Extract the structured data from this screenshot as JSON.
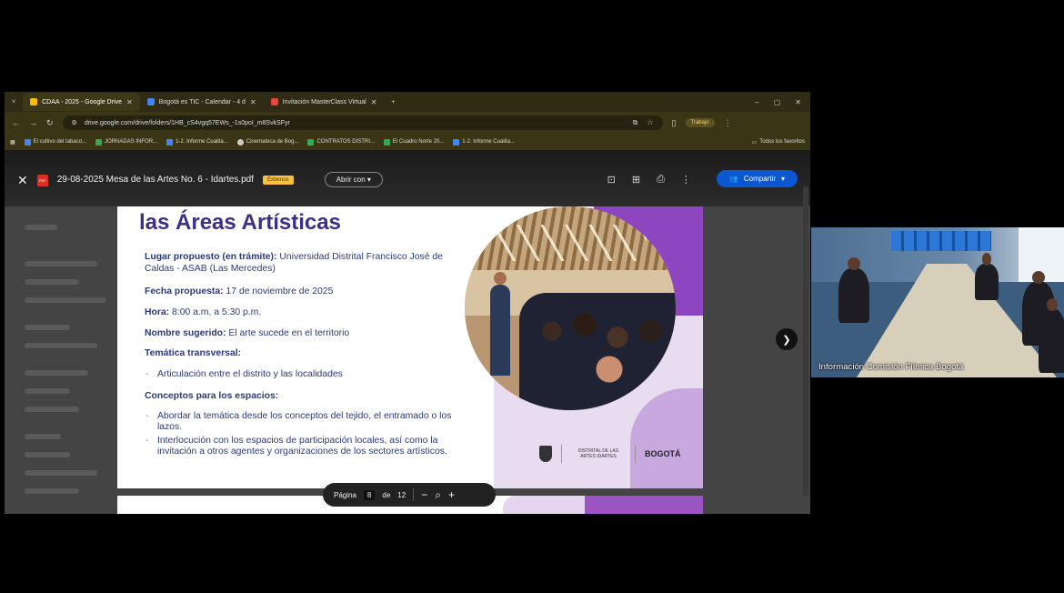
{
  "browser": {
    "tabs": [
      {
        "label": "CDAA - 2025 - Google Drive",
        "color": "#fbbc04",
        "active": true
      },
      {
        "label": "Bogotá es TIC - Calendar - 4 d",
        "color": "#4285f4",
        "active": false
      },
      {
        "label": "Invitación MasterClass Virtual",
        "color": "#ea4335",
        "active": false
      }
    ],
    "new_tab": "+",
    "url": "drive.google.com/drive/folders/1HB_cS4vgq57EWs_-1s0poI_m8SvkSFyr",
    "profile_label": "Trabajo",
    "bookmarks": [
      {
        "label": "El cultivo del tabaco...",
        "color": "#4285f4"
      },
      {
        "label": "JORNADAS INFOR...",
        "color": "#34a853"
      },
      {
        "label": "1-2. Informe Cualita...",
        "color": "#4285f4"
      },
      {
        "label": "Cinemateca de Bog...",
        "color": "#cccccc"
      },
      {
        "label": "CONTRATOS DISTRI...",
        "color": "#34a853"
      },
      {
        "label": "El Cuadro Norte 20...",
        "color": "#34a853"
      },
      {
        "label": "1-2. Informe Cualita...",
        "color": "#4285f4"
      }
    ],
    "all_bookmarks": "Todos los favoritos"
  },
  "viewer": {
    "file_name": "29-08-2025 Mesa de las Artes No. 6 - Idartes.pdf",
    "external_badge": "Externos",
    "open_with": "Abrir con",
    "share_label": "Compartir"
  },
  "slide": {
    "title": "las Áreas Artísticas",
    "lugar_label": "Lugar propuesto (en trámite):",
    "lugar_value": " Universidad Distrital Francisco José de Caldas - ASAB (Las Mercedes)",
    "fecha_label": "Fecha propuesta:",
    "fecha_value": " 17 de noviembre de 2025",
    "hora_label": "Hora:",
    "hora_value": " 8:00 a.m. a 5:30 p.m.",
    "nombre_label": "Nombre sugerido:",
    "nombre_value": " El arte sucede en el territorio",
    "tematica_label": "Temática transversal:",
    "tematica_bullet": "Articulación entre el distrito y las localidades",
    "conceptos_label": "Conceptos para los espacios:",
    "conceptos_bullets": [
      "Abordar la temática desde los conceptos del tejido, el entramado o los lazos.",
      "Interlocución con los espacios de participación locales, así como la invitación a otros agentes y organizaciones de los sectores artísticos."
    ],
    "logo_idartes": "DISTRITAL DE LAS ARTES IDARTES",
    "logo_bogota": "BOGOTÁ"
  },
  "pager": {
    "label": "Página",
    "current": "8",
    "of": "de",
    "total": "12"
  },
  "video": {
    "participant_name": "Información Comisión Fílmica Bogotá"
  }
}
